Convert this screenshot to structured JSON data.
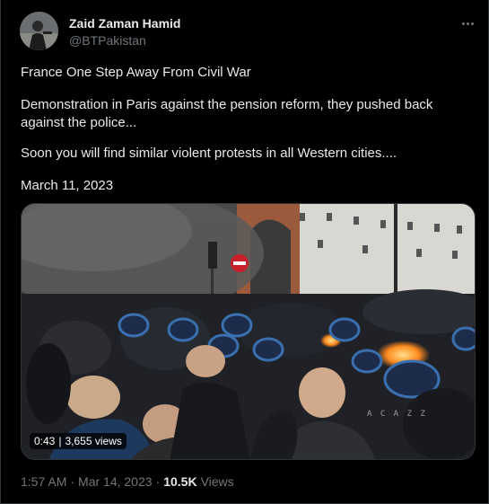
{
  "author": {
    "name": "Zaid Zaman Hamid",
    "handle": "@BTPakistan",
    "avatar_icon": "avatar-photo"
  },
  "tweet": {
    "line1": "France One Step Away From Civil War",
    "line2": "Demonstration in Paris against the pension reform, they pushed back against the police...",
    "line3": "Soon you will find similar violent protests in all Western cities....",
    "line4": "March 11, 2023"
  },
  "video": {
    "duration": "0:43",
    "separator": "|",
    "views": "3,655 views",
    "watermark": "A C A Z Z"
  },
  "footer": {
    "time": "1:57 AM",
    "dot1": "·",
    "date": "Mar 14, 2023",
    "dot2": "·",
    "views_count": "10.5K",
    "views_label": "Views"
  },
  "colors": {
    "background": "#000000",
    "text": "#e7e9ea",
    "secondary": "#71767b",
    "border": "#2f3336"
  }
}
